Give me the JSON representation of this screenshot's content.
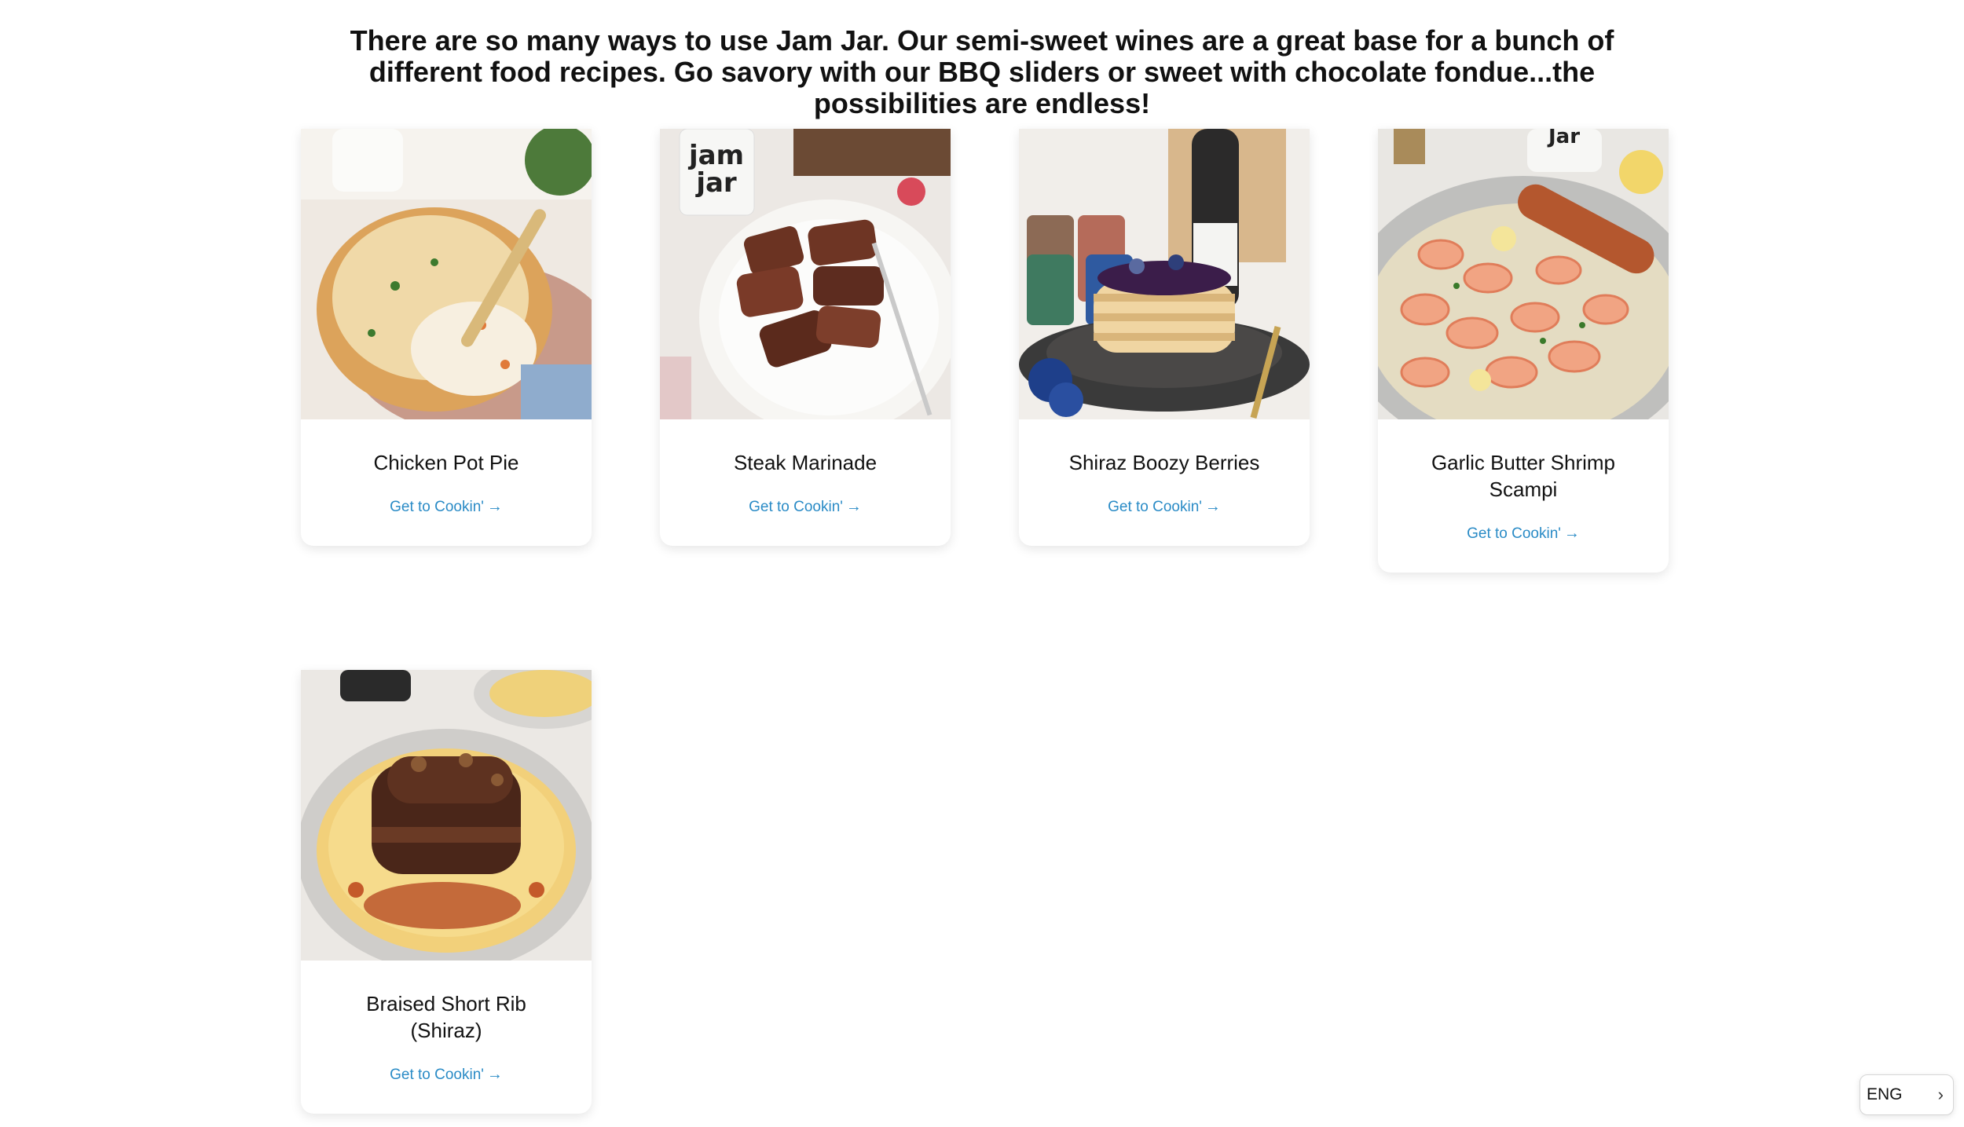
{
  "intro": {
    "text": "There are so many ways to use Jam Jar. Our semi-sweet wines are a great base for a bunch of different food recipes. Go savory with our BBQ sliders or sweet with chocolate fondue...the possibilities are endless!"
  },
  "recipes": [
    {
      "title": "Chicken Pot Pie",
      "cta": "Get to Cookin'",
      "image": "chicken-pot-pie-photo"
    },
    {
      "title": "Steak Marinade",
      "cta": "Get to Cookin'",
      "image": "steak-marinade-photo"
    },
    {
      "title": "Shiraz Boozy Berries",
      "cta": "Get to Cookin'",
      "image": "shiraz-boozy-berries-photo"
    },
    {
      "title": "Garlic Butter Shrimp Scampi",
      "cta": "Get to Cookin'",
      "image": "garlic-butter-shrimp-scampi-photo"
    },
    {
      "title": "Braised Short Rib (Shiraz)",
      "cta": "Get to Cookin'",
      "image": "braised-short-rib-photo"
    }
  ],
  "arrow_icon": "arrow-right-icon",
  "language": {
    "label": "ENG",
    "icon": "chevron-right-icon"
  },
  "colors": {
    "link": "#2a8bc6",
    "text": "#111111",
    "background": "#ffffff"
  }
}
